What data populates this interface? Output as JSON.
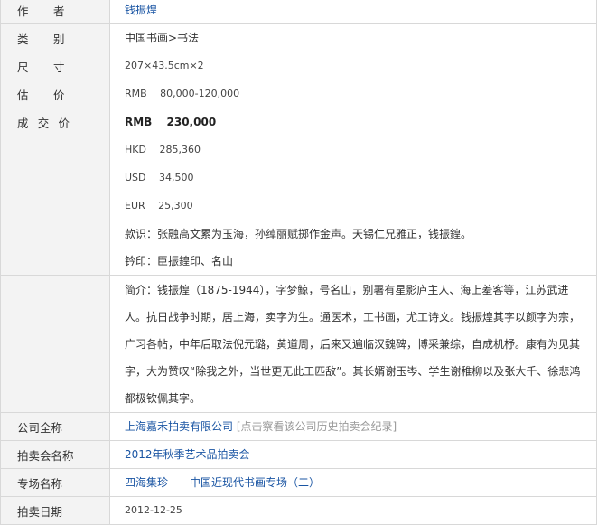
{
  "rows": {
    "author": {
      "label": "作　者",
      "value": "钱振煌"
    },
    "category": {
      "label": "类　别",
      "value": "中国书画>书法"
    },
    "size": {
      "label": "尺　寸",
      "value": "207×43.5cm×2"
    },
    "estimate": {
      "label": "估　价",
      "value": "RMB　 80,000-120,000"
    },
    "deal": {
      "label": "成 交 价",
      "value": "RMB　 230,000",
      "hkd": "HKD　 285,360",
      "usd": "USD　 34,500",
      "eur": "EUR　 25,300"
    },
    "inscription": {
      "text": "款识：张融高文累为玉海，孙绰丽赋掷作金声。天锡仁兄雅正，钱振鍠。",
      "seal": "钤印：臣振鍠印、名山"
    },
    "bio": "简介：钱振煌（1875-1944），字梦鲸，号名山，别署有星影庐主人、海上羞客等，江苏武进人。抗日战争时期，居上海，卖字为生。通医术，工书画，尤工诗文。钱振煌其字以颜字为宗，广习各帖，中年后取法倪元璐，黄道周，后来又遍临汉魏碑，博采兼综，自成机杼。康有为见其字，大为赞叹“除我之外，当世更无此工匹敌”。其长婿谢玉岑、学生谢稚柳以及张大千、徐悲鸿都极钦佩其字。",
    "company": {
      "label": "公司全称",
      "name": "上海嘉禾拍卖有限公司",
      "history_link": "[点击察看该公司历史拍卖会纪录]"
    },
    "auction": {
      "label": "拍卖会名称",
      "value": "2012年秋季艺术品拍卖会"
    },
    "session": {
      "label": "专场名称",
      "value": "四海集珍——中国近现代书画专场（二）"
    },
    "date": {
      "label": "拍卖日期",
      "value": "2012-12-25"
    }
  }
}
